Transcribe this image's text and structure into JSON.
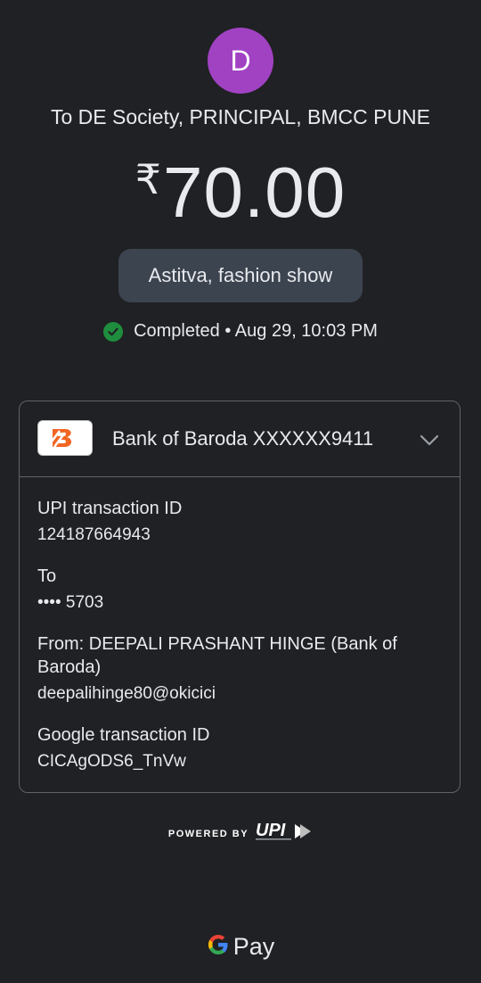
{
  "avatar": {
    "initial": "D",
    "color": "#a142c3"
  },
  "recipient": "To DE Society, PRINCIPAL, BMCC PUNE",
  "amount": {
    "currency": "₹",
    "value": "70.00"
  },
  "note": "Astitva, fashion show",
  "status": {
    "icon": "check-circle-icon",
    "text": "Completed • Aug 29, 10:03 PM",
    "color": "#1e8e3e"
  },
  "account": {
    "bank_logo": "bank-of-baroda-logo",
    "name": "Bank of Baroda XXXXXX9411",
    "expand_icon": "chevron-down-icon"
  },
  "details": [
    {
      "label": "UPI transaction ID",
      "value": "124187664943"
    },
    {
      "label": "To",
      "value": "•••• 5703"
    },
    {
      "label": "From: DEEPALI PRASHANT HINGE (Bank of Baroda)",
      "value": "deepalihinge80@okicici"
    },
    {
      "label": "Google transaction ID",
      "value": "CICAgODS6_TnVw"
    }
  ],
  "footer": {
    "powered_by": "POWERED BY",
    "upi_logo": "UPI",
    "gpay_label": "Pay"
  }
}
